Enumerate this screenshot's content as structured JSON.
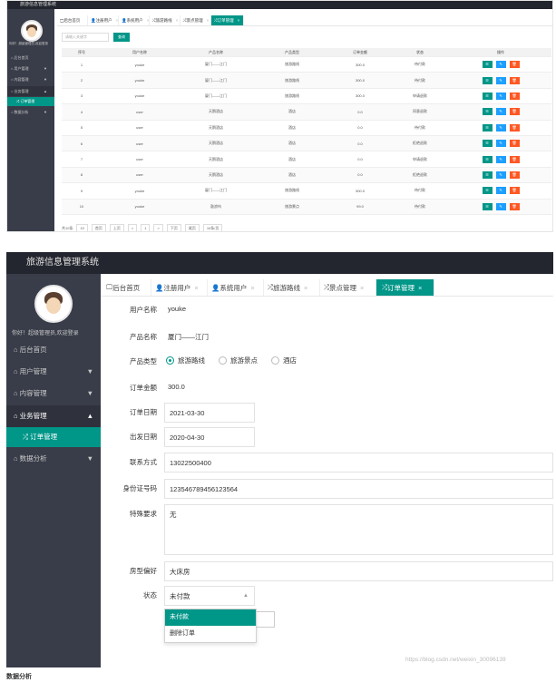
{
  "app": {
    "title": "旅游信息管理系统"
  },
  "user": {
    "greeting": "你好！超级管理员,欢迎登录"
  },
  "sidebar": {
    "items": [
      {
        "label": "后台首页",
        "icon": "house-icon"
      },
      {
        "label": "用户管理",
        "icon": "house-icon",
        "caret": "▼"
      },
      {
        "label": "内容管理",
        "icon": "house-icon",
        "caret": "▼"
      },
      {
        "label": "业务管理",
        "icon": "house-icon",
        "caret": "▲"
      },
      {
        "label": "订单管理",
        "icon": "shuffle-icon"
      },
      {
        "label": "数据分析",
        "icon": "house-icon",
        "caret": "▼"
      }
    ]
  },
  "tabs": [
    {
      "label": "后台首页",
      "icon": "monitor-icon"
    },
    {
      "label": "注册用户",
      "icon": "person-icon",
      "close": "×"
    },
    {
      "label": "系统用户",
      "icon": "person-icon",
      "close": "×"
    },
    {
      "label": "旅游路线",
      "icon": "shuffle-icon",
      "close": "×"
    },
    {
      "label": "景点管理",
      "icon": "shuffle-icon",
      "close": "×"
    },
    {
      "label": "订单管理",
      "icon": "shuffle-icon",
      "close": "×"
    }
  ],
  "search": {
    "placeholder": "请输入关键字",
    "button": "查询"
  },
  "table": {
    "headers": [
      "序号",
      "用户名称",
      "产品名称",
      "产品类型",
      "订单金额",
      "状态",
      "操作"
    ],
    "rows": [
      [
        "1",
        "youke",
        "厦门——江门",
        "旅游路线",
        "300.0",
        "待付款"
      ],
      [
        "2",
        "youke",
        "厦门——江门",
        "旅游路线",
        "300.0",
        "待付款"
      ],
      [
        "3",
        "youke",
        "厦门——江门",
        "旅游路线",
        "300.0",
        "申请退款"
      ],
      [
        "4",
        "user",
        "天鹅酒店",
        "酒店",
        "0.0",
        "同意退款"
      ],
      [
        "5",
        "user",
        "天鹅酒店",
        "酒店",
        "0.0",
        "待付款"
      ],
      [
        "6",
        "user",
        "天鹅酒店",
        "酒店",
        "0.0",
        "拒绝退款"
      ],
      [
        "7",
        "user",
        "天鹅酒店",
        "酒店",
        "0.0",
        "申请退款"
      ],
      [
        "8",
        "user",
        "天鹅酒店",
        "酒店",
        "0.0",
        "拒绝退款"
      ],
      [
        "9",
        "youke",
        "厦门——江门",
        "旅游路线",
        "300.0",
        "待付款"
      ],
      [
        "10",
        "youke",
        "鼓浪屿",
        "旅游景点",
        "99.0",
        "待付款"
      ]
    ],
    "ops": [
      "☰",
      "✎",
      "🗑"
    ]
  },
  "pager": {
    "total": "共10条",
    "size": "10",
    "first": "首页",
    "prev": "上页",
    "lt": "<",
    "page": "1",
    "gt": ">",
    "next": "下页",
    "last": "尾页",
    "per": "10条/页"
  },
  "form": {
    "username_label": "用户名称",
    "username": "youke",
    "product_label": "产品名称",
    "product": "厦门——江门",
    "type_label": "产品类型",
    "types": [
      "旅游路线",
      "旅游景点",
      "酒店"
    ],
    "amount_label": "订单金额",
    "amount": "300.0",
    "order_date_label": "订单日期",
    "order_date": "2021-03-30",
    "depart_label": "出发日期",
    "depart": "2020-04-30",
    "contact_label": "联系方式",
    "contact": "13022500400",
    "idcard_label": "身份证号码",
    "idcard": "123546789456123564",
    "special_label": "特殊要求",
    "special": "无",
    "room_label": "房型偏好",
    "room": "大床房",
    "status_label": "状态",
    "status": "未付款",
    "status_options": [
      "未付款",
      "删除订单"
    ]
  },
  "watermark": "https://blog.csdn.net/weixin_30096139",
  "caption": "数据分析"
}
